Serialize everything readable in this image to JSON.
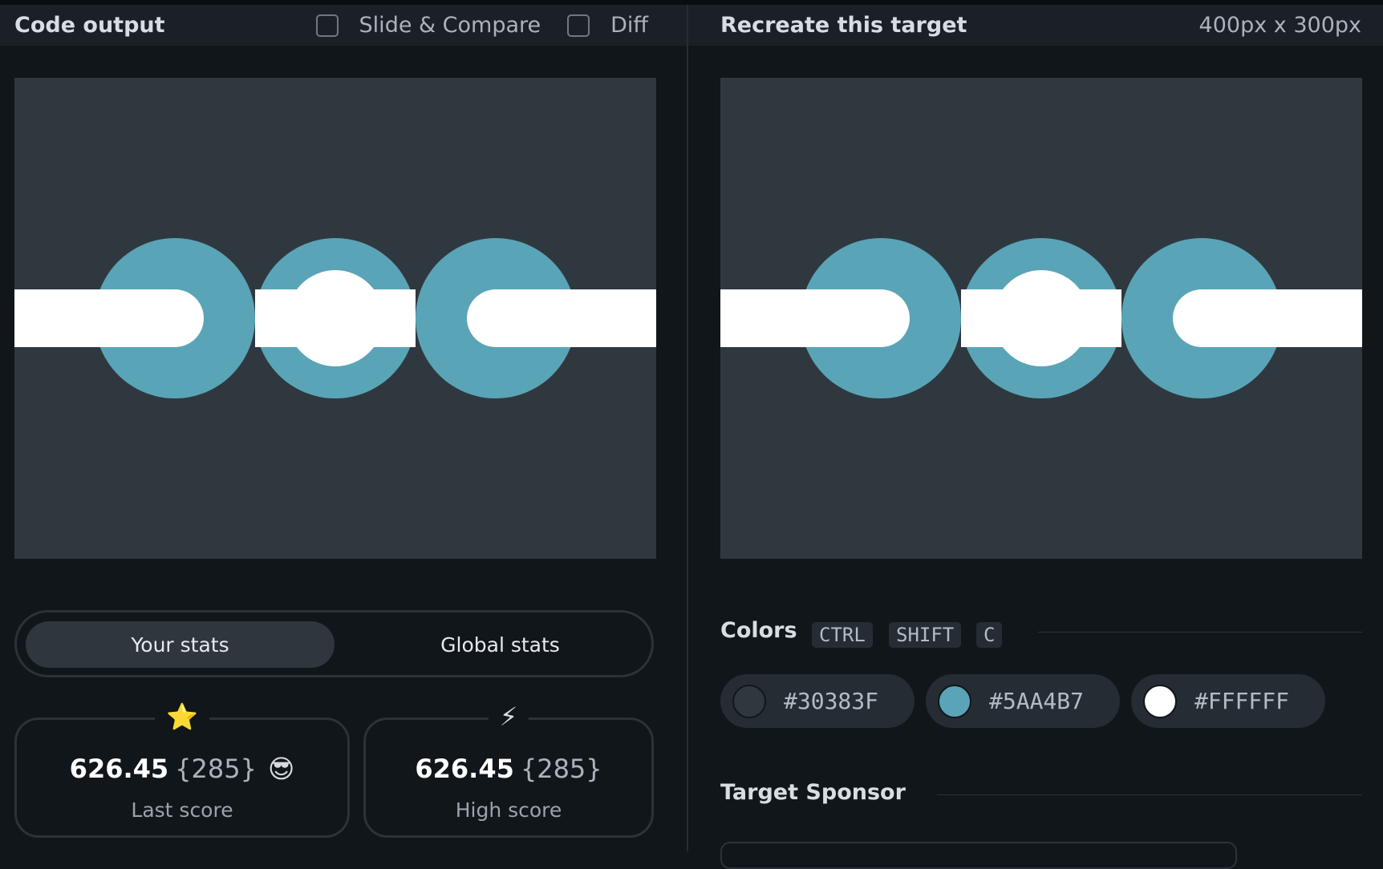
{
  "left_header": {
    "title": "Code output",
    "slide_compare_label": "Slide & Compare",
    "diff_label": "Diff"
  },
  "right_header": {
    "title": "Recreate this target",
    "dimensions": "400px x 300px"
  },
  "canvas_colors": {
    "background": "#30383F",
    "ring": "#5AA4B7",
    "bar": "#FFFFFF"
  },
  "stats": {
    "tabs": {
      "active": "Your stats",
      "inactive": "Global stats"
    },
    "last": {
      "icon": "⭐",
      "value": "626.45",
      "count": "{285}",
      "emoji": "😎",
      "label": "Last score"
    },
    "high": {
      "icon": "⚡",
      "value": "626.45",
      "count": "{285}",
      "label": "High score"
    }
  },
  "colors_section": {
    "title": "Colors",
    "shortcut_keys": [
      "CTRL",
      "SHIFT",
      "C"
    ],
    "swatches": [
      {
        "hex": "#30383F",
        "color": "#30383F"
      },
      {
        "hex": "#5AA4B7",
        "color": "#5AA4B7"
      },
      {
        "hex": "#FFFFFF",
        "color": "#FFFFFF"
      }
    ]
  },
  "sponsor_section": {
    "title": "Target Sponsor"
  }
}
